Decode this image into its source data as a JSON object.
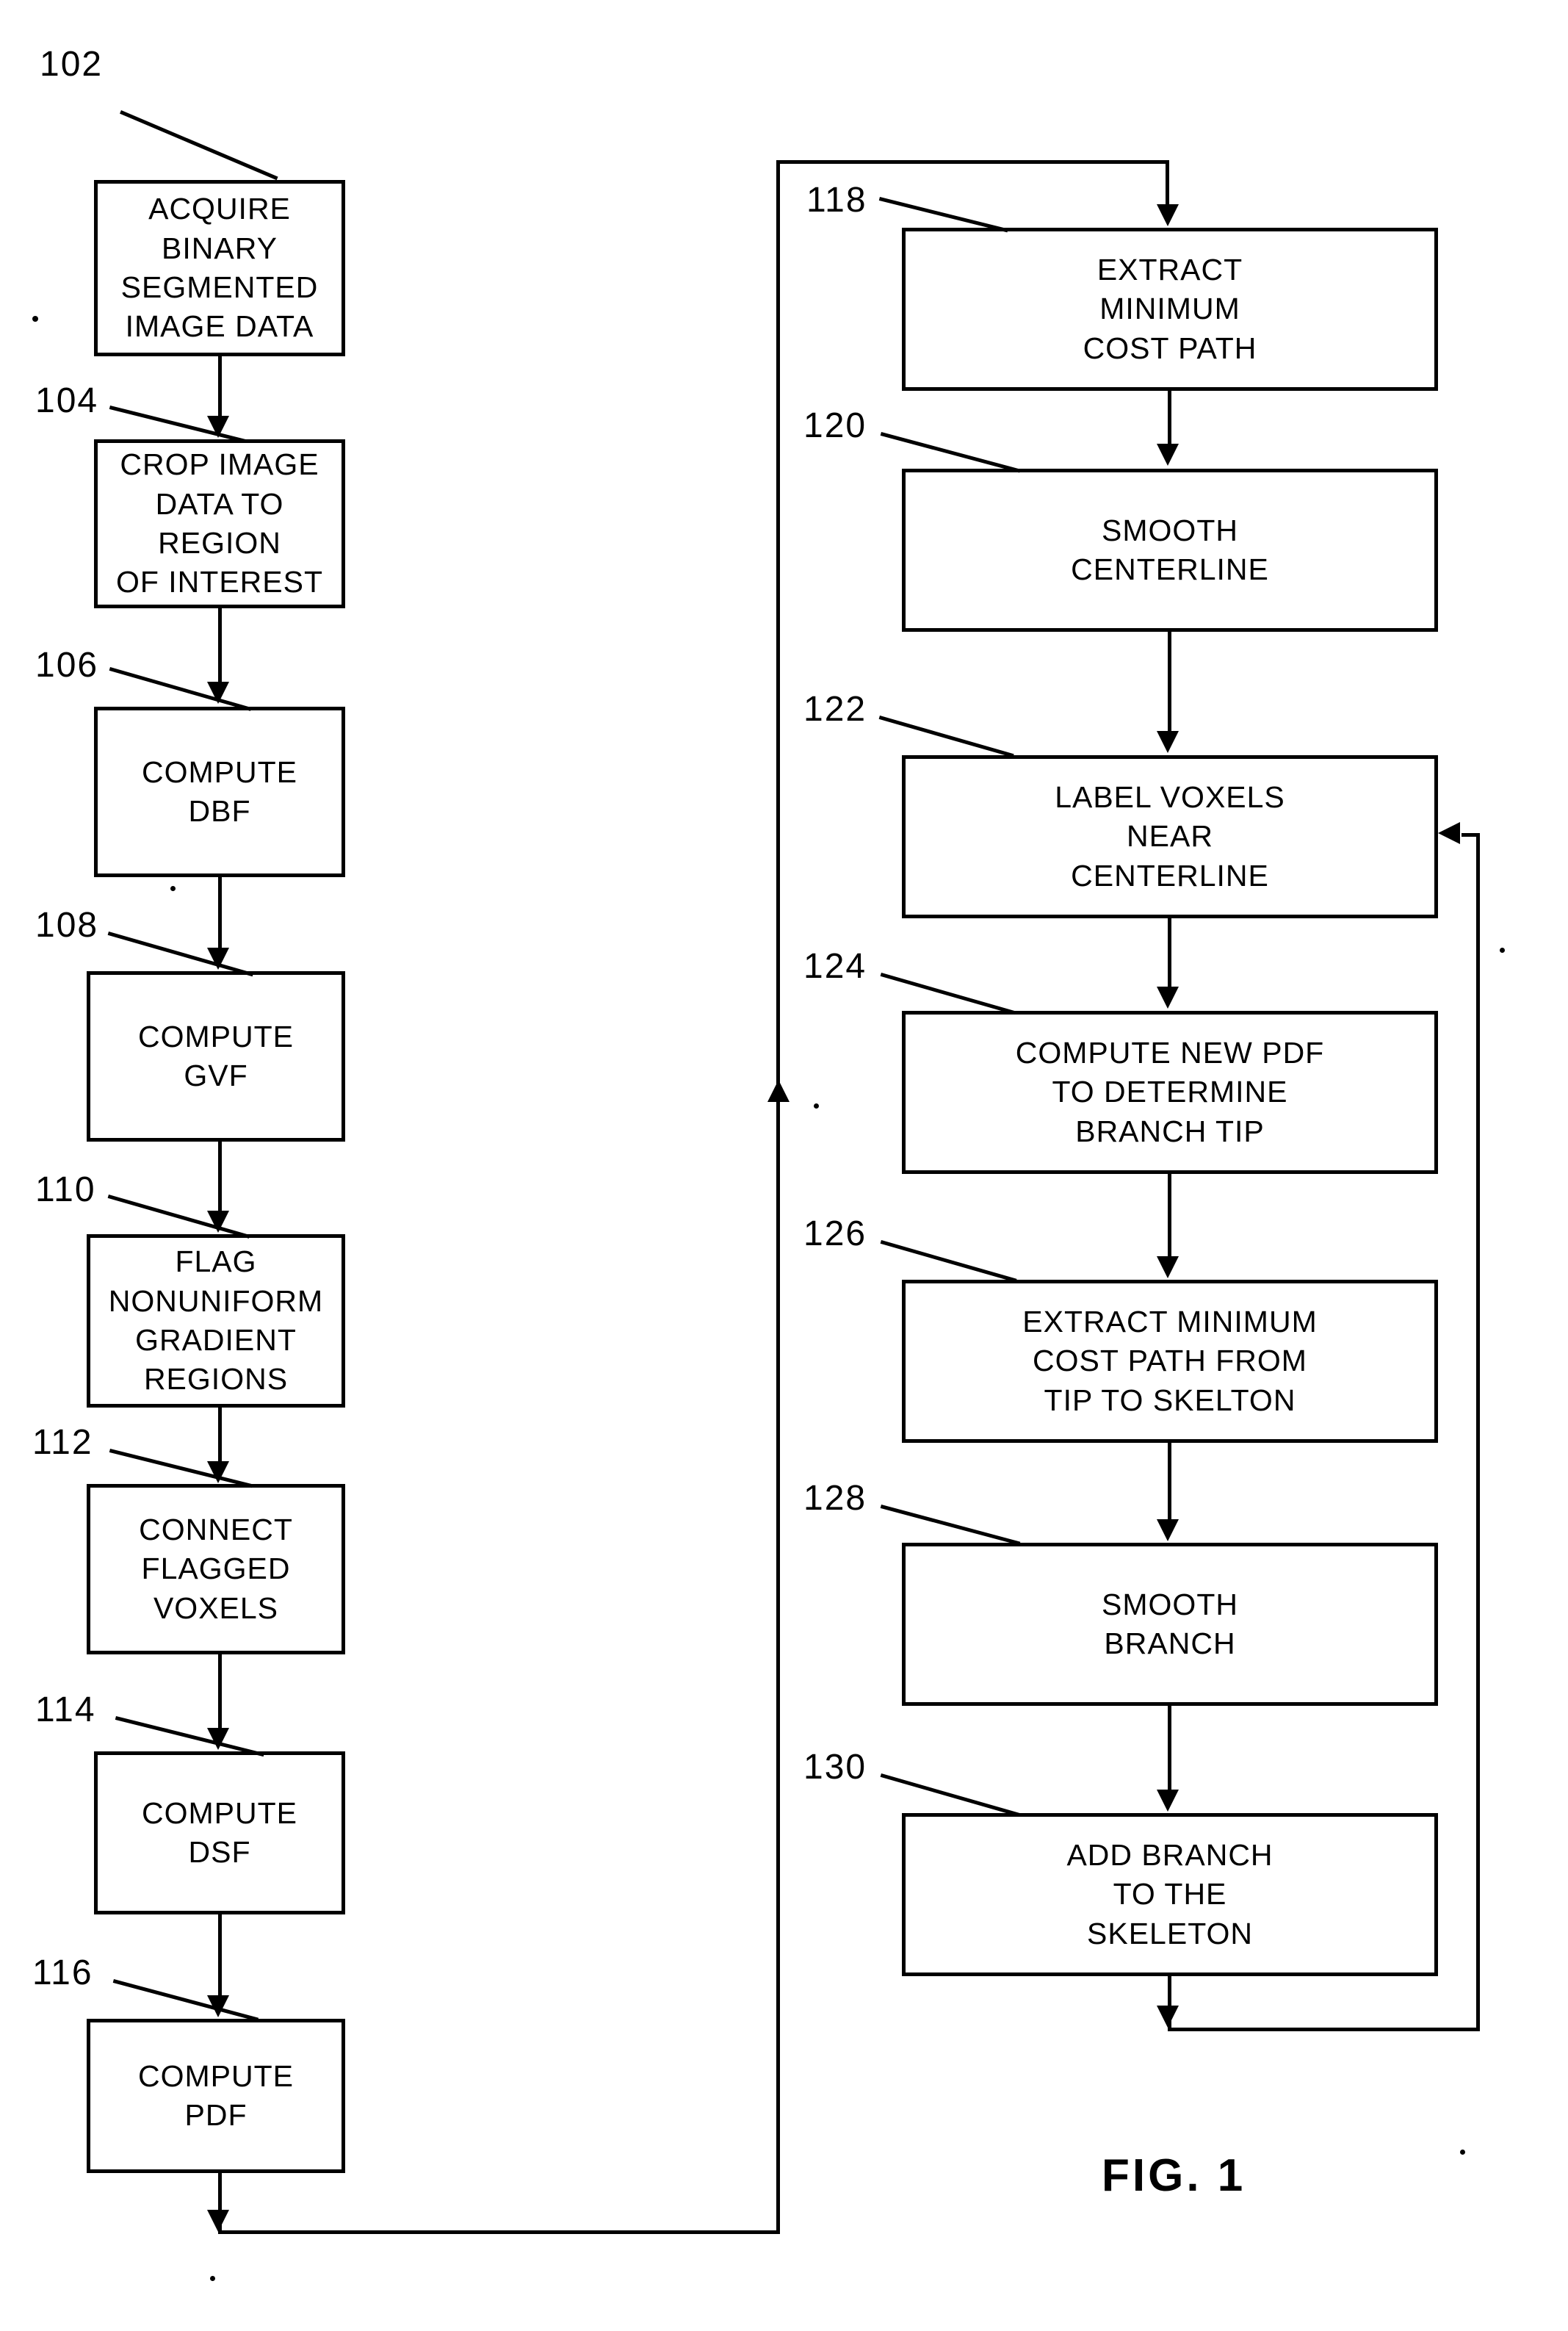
{
  "figure": {
    "caption": "FIG. 1",
    "type": "process-flowchart",
    "orientation": "two-column"
  },
  "left_column": {
    "nodes": [
      {
        "ref": "102",
        "text": "ACQUIRE BINARY\nSEGMENTED\nIMAGE DATA"
      },
      {
        "ref": "104",
        "text": "CROP IMAGE\nDATA TO REGION\nOF INTEREST"
      },
      {
        "ref": "106",
        "text": "COMPUTE\nDBF"
      },
      {
        "ref": "108",
        "text": "COMPUTE\nGVF"
      },
      {
        "ref": "110",
        "text": "FLAG NONUNIFORM\nGRADIENT\nREGIONS"
      },
      {
        "ref": "112",
        "text": "CONNECT\nFLAGGED\nVOXELS"
      },
      {
        "ref": "114",
        "text": "COMPUTE\nDSF"
      },
      {
        "ref": "116",
        "text": "COMPUTE\nPDF"
      }
    ]
  },
  "right_column": {
    "nodes": [
      {
        "ref": "118",
        "text": "EXTRACT\nMINIMUM\nCOST PATH"
      },
      {
        "ref": "120",
        "text": "SMOOTH\nCENTERLINE"
      },
      {
        "ref": "122",
        "text": "LABEL VOXELS\nNEAR\nCENTERLINE"
      },
      {
        "ref": "124",
        "text": "COMPUTE NEW PDF\nTO DETERMINE\nBRANCH TIP"
      },
      {
        "ref": "126",
        "text": "EXTRACT MINIMUM\nCOST PATH FROM\nTIP TO SKELTON"
      },
      {
        "ref": "128",
        "text": "SMOOTH\nBRANCH"
      },
      {
        "ref": "130",
        "text": "ADD BRANCH\nTO THE\nSKELETON"
      }
    ]
  },
  "colors": {
    "ink": "#000000",
    "paper": "#ffffff"
  }
}
